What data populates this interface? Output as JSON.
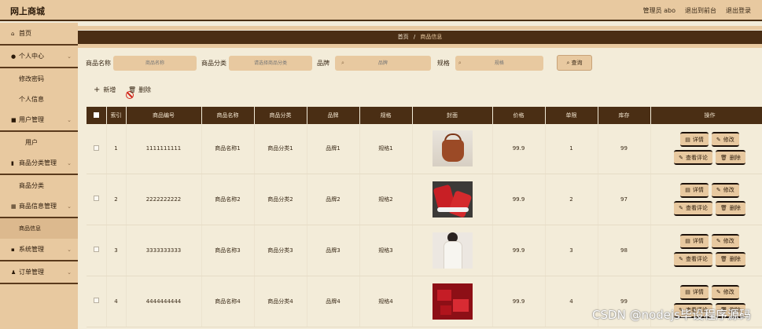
{
  "header": {
    "brand": "网上商城",
    "admin": "管理员 abo",
    "back_front": "退出到前台",
    "logout": "退出登录"
  },
  "sidebar": {
    "items": [
      {
        "label": "首页",
        "icon": "home-icon"
      },
      {
        "label": "个人中心",
        "icon": "user-icon"
      },
      {
        "label": "修改密码"
      },
      {
        "label": "个人信息"
      },
      {
        "label": "用户管理",
        "icon": "checkbox-icon"
      },
      {
        "label": "用户"
      },
      {
        "label": "商品分类管理",
        "icon": "chart-icon"
      },
      {
        "label": "商品分类"
      },
      {
        "label": "商品信息管理",
        "icon": "grid-icon"
      },
      {
        "label": "商品信息"
      },
      {
        "label": "系统管理",
        "icon": "apps-icon"
      },
      {
        "label": "订单管理",
        "icon": "person-icon"
      }
    ]
  },
  "breadcrumb": {
    "home": "首页",
    "sep": "/",
    "current": "商品信息"
  },
  "search": {
    "name_label": "商品名称",
    "name_placeholder": "商品名称",
    "category_label": "商品分类",
    "category_placeholder": "请选择商品分类",
    "brand_label": "品牌",
    "brand_placeholder": "品牌",
    "spec_label": "规格",
    "spec_placeholder": "规格",
    "query": "查询"
  },
  "actions": {
    "add": "新增",
    "delete": "删除"
  },
  "table": {
    "headers": [
      "索引",
      "商品编号",
      "商品名称",
      "商品分类",
      "品牌",
      "规格",
      "封面",
      "价格",
      "单限",
      "库存",
      "操作"
    ],
    "rows": [
      {
        "index": "1",
        "code": "1111111111",
        "name": "商品名称1",
        "category": "商品分类1",
        "brand": "品牌1",
        "spec": "规格1",
        "price": "99.9",
        "limit": "1",
        "stock": "99"
      },
      {
        "index": "2",
        "code": "2222222222",
        "name": "商品名称2",
        "category": "商品分类2",
        "brand": "品牌2",
        "spec": "规格2",
        "price": "99.9",
        "limit": "2",
        "stock": "97"
      },
      {
        "index": "3",
        "code": "3333333333",
        "name": "商品名称3",
        "category": "商品分类3",
        "brand": "品牌3",
        "spec": "规格3",
        "price": "99.9",
        "limit": "3",
        "stock": "98"
      },
      {
        "index": "4",
        "code": "4444444444",
        "name": "商品名称4",
        "category": "商品分类4",
        "brand": "品牌4",
        "spec": "规格4",
        "price": "99.9",
        "limit": "4",
        "stock": "99"
      }
    ],
    "op_detail": "详情",
    "op_edit": "修改",
    "op_comments": "查看评论",
    "op_delete": "删除"
  },
  "watermark": "CSDN @nodejs毕设程序源码",
  "colors": {
    "accent_dark": "#4a2e14",
    "accent_light": "#e8c9a0",
    "background": "#f3ecd9"
  }
}
